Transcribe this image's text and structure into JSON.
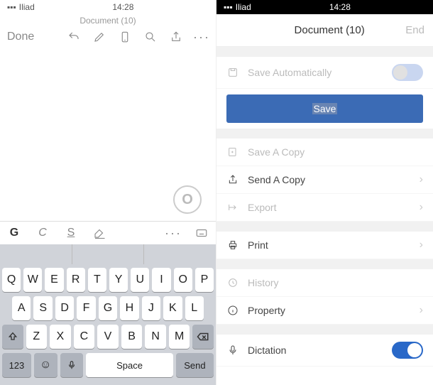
{
  "status": {
    "carrier": "Iliad",
    "time": "14:28",
    "signal_icon": "signal-bars",
    "wifi_icon": "wifi",
    "battery_icon": "battery"
  },
  "left": {
    "doc_title": "Document (10)",
    "done": "Done",
    "toolbar": [
      "undo",
      "pencil",
      "phone",
      "search",
      "share",
      "more"
    ],
    "watermark": "O",
    "format": {
      "bold": "G",
      "italic": "C",
      "underline": "S"
    },
    "keyboard": {
      "row1": [
        "Q",
        "W",
        "E",
        "R",
        "T",
        "Y",
        "U",
        "I",
        "O",
        "P"
      ],
      "row2": [
        "A",
        "S",
        "D",
        "F",
        "G",
        "H",
        "J",
        "K",
        "L"
      ],
      "row3": [
        "Z",
        "X",
        "C",
        "V",
        "B",
        "N",
        "M"
      ],
      "num": "123",
      "space": "Space",
      "send": "Send"
    }
  },
  "right": {
    "title": "Document (10)",
    "end": "End",
    "save_auto": "Save Automatically",
    "save_btn": "Save",
    "items": {
      "save_copy": "Save A Copy",
      "send_copy": "Send A Copy",
      "export": "Export",
      "print": "Print",
      "history": "History",
      "property": "Property",
      "dictation": "Dictation"
    },
    "toggles": {
      "save_auto": false,
      "dictation": true
    }
  }
}
